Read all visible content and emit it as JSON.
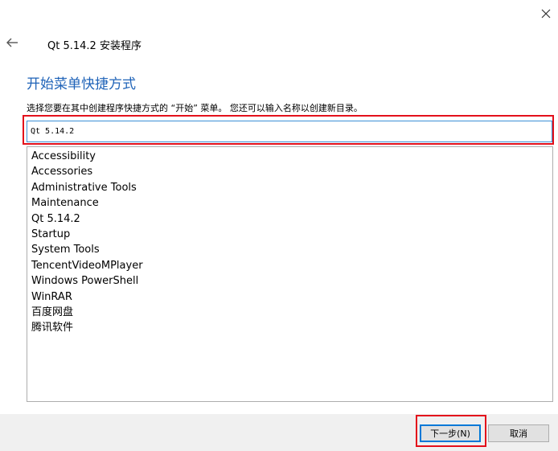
{
  "window": {
    "app_title": "Qt 5.14.2 安装程序"
  },
  "page": {
    "heading": "开始菜单快捷方式",
    "instruction": "选择您要在其中创建程序快捷方式的 “开始” 菜单。 您还可以输入名称以创建新目录。"
  },
  "folder_name_input": {
    "value": "Qt 5.14.2"
  },
  "folders": [
    "Accessibility",
    "Accessories",
    "Administrative Tools",
    "Maintenance",
    "Qt 5.14.2",
    "Startup",
    "System Tools",
    "TencentVideoMPlayer",
    "Windows PowerShell",
    "WinRAR",
    "百度网盘",
    "腾讯软件"
  ],
  "buttons": {
    "next_label": "下一步(N)",
    "cancel_label": "取消"
  },
  "icons": {
    "close": "close-icon",
    "back": "back-arrow-icon"
  },
  "colors": {
    "heading": "#1f63b8",
    "highlight_frame": "#e3101b",
    "input_focus_border": "#3c8fd6",
    "footer_bg": "#f0f0f0"
  }
}
